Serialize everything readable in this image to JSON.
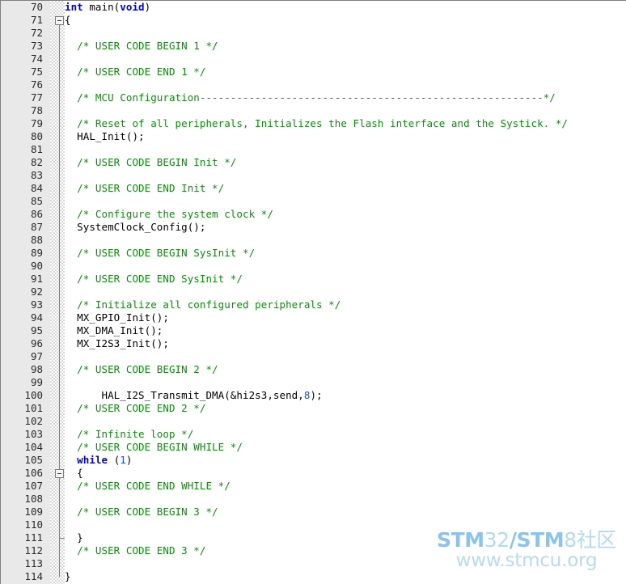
{
  "editor": {
    "language": "c",
    "first_line_number": 70,
    "last_line_number": 114,
    "gutter_bg": "#e9e9e9",
    "background": "#ffffff",
    "comment_color": "#128a12",
    "keyword_color": "#0000d0",
    "number_color": "#1a4fd0",
    "text_color": "#000000"
  },
  "lines": [
    {
      "n": "70",
      "tokens": [
        {
          "t": "int ",
          "c": "kw"
        },
        {
          "t": "main(",
          "c": "pln"
        },
        {
          "t": "void",
          "c": "kw"
        },
        {
          "t": ")",
          "c": "pln"
        }
      ]
    },
    {
      "n": "71",
      "fold": "open",
      "tokens": [
        {
          "t": "{",
          "c": "pln"
        }
      ]
    },
    {
      "n": "72",
      "tokens": []
    },
    {
      "n": "73",
      "tokens": [
        {
          "t": "  /* USER CODE BEGIN 1 */",
          "c": "cmt"
        }
      ]
    },
    {
      "n": "74",
      "tokens": []
    },
    {
      "n": "75",
      "tokens": [
        {
          "t": "  /* USER CODE END 1 */",
          "c": "cmt"
        }
      ]
    },
    {
      "n": "76",
      "tokens": []
    },
    {
      "n": "77",
      "tokens": [
        {
          "t": "  /* MCU Configuration--------------------------------------------------------*/",
          "c": "cmt"
        }
      ]
    },
    {
      "n": "78",
      "tokens": []
    },
    {
      "n": "79",
      "tokens": [
        {
          "t": "  /* Reset of all peripherals, Initializes the Flash interface and the Systick. */",
          "c": "cmt"
        }
      ]
    },
    {
      "n": "80",
      "tokens": [
        {
          "t": "  HAL_Init();",
          "c": "pln"
        }
      ]
    },
    {
      "n": "81",
      "tokens": []
    },
    {
      "n": "82",
      "tokens": [
        {
          "t": "  /* USER CODE BEGIN Init */",
          "c": "cmt"
        }
      ]
    },
    {
      "n": "83",
      "tokens": []
    },
    {
      "n": "84",
      "tokens": [
        {
          "t": "  /* USER CODE END Init */",
          "c": "cmt"
        }
      ]
    },
    {
      "n": "85",
      "tokens": []
    },
    {
      "n": "86",
      "tokens": [
        {
          "t": "  /* Configure the system clock */",
          "c": "cmt"
        }
      ]
    },
    {
      "n": "87",
      "tokens": [
        {
          "t": "  SystemClock_Config();",
          "c": "pln"
        }
      ]
    },
    {
      "n": "88",
      "tokens": []
    },
    {
      "n": "89",
      "tokens": [
        {
          "t": "  /* USER CODE BEGIN SysInit */",
          "c": "cmt"
        }
      ]
    },
    {
      "n": "90",
      "tokens": []
    },
    {
      "n": "91",
      "tokens": [
        {
          "t": "  /* USER CODE END SysInit */",
          "c": "cmt"
        }
      ]
    },
    {
      "n": "92",
      "tokens": []
    },
    {
      "n": "93",
      "tokens": [
        {
          "t": "  /* Initialize all configured peripherals */",
          "c": "cmt"
        }
      ]
    },
    {
      "n": "94",
      "tokens": [
        {
          "t": "  MX_GPIO_Init();",
          "c": "pln"
        }
      ]
    },
    {
      "n": "95",
      "tokens": [
        {
          "t": "  MX_DMA_Init();",
          "c": "pln"
        }
      ]
    },
    {
      "n": "96",
      "tokens": [
        {
          "t": "  MX_I2S3_Init();",
          "c": "pln"
        }
      ]
    },
    {
      "n": "97",
      "tokens": []
    },
    {
      "n": "98",
      "tokens": [
        {
          "t": "  /* USER CODE BEGIN 2 */",
          "c": "cmt"
        }
      ]
    },
    {
      "n": "99",
      "tokens": []
    },
    {
      "n": "100",
      "tokens": [
        {
          "t": "      HAL_I2S_Transmit_DMA(&hi2s3,send,",
          "c": "pln"
        },
        {
          "t": "8",
          "c": "num"
        },
        {
          "t": ");",
          "c": "pln"
        }
      ]
    },
    {
      "n": "101",
      "tokens": [
        {
          "t": "  /* USER CODE END 2 */",
          "c": "cmt"
        }
      ]
    },
    {
      "n": "102",
      "tokens": []
    },
    {
      "n": "103",
      "tokens": [
        {
          "t": "  /* Infinite loop */",
          "c": "cmt"
        }
      ]
    },
    {
      "n": "104",
      "tokens": [
        {
          "t": "  /* USER CODE BEGIN WHILE */",
          "c": "cmt"
        }
      ]
    },
    {
      "n": "105",
      "tokens": [
        {
          "t": "  ",
          "c": "pln"
        },
        {
          "t": "while",
          "c": "kw"
        },
        {
          "t": " (",
          "c": "pln"
        },
        {
          "t": "1",
          "c": "num"
        },
        {
          "t": ")",
          "c": "pln"
        }
      ]
    },
    {
      "n": "106",
      "fold": "open",
      "tokens": [
        {
          "t": "  {",
          "c": "pln"
        }
      ]
    },
    {
      "n": "107",
      "tokens": [
        {
          "t": "  /* USER CODE END WHILE */",
          "c": "cmt"
        }
      ]
    },
    {
      "n": "108",
      "tokens": []
    },
    {
      "n": "109",
      "tokens": [
        {
          "t": "  /* USER CODE BEGIN 3 */",
          "c": "cmt"
        }
      ]
    },
    {
      "n": "110",
      "tokens": []
    },
    {
      "n": "111",
      "fold": "end",
      "tokens": [
        {
          "t": "  }",
          "c": "pln"
        }
      ]
    },
    {
      "n": "112",
      "tokens": [
        {
          "t": "  /* USER CODE END 3 */",
          "c": "cmt"
        }
      ]
    },
    {
      "n": "113",
      "tokens": []
    },
    {
      "n": "114",
      "tokens": [
        {
          "t": "}",
          "c": "pln"
        }
      ]
    }
  ],
  "watermark": {
    "brand_bold_1": "STM",
    "brand_light_1": "32",
    "brand_bold_2": "/STM",
    "brand_light_2": "8社区",
    "url": "www.stmcu.org",
    "color_bold": "#8cc3e9",
    "color_light": "#b5d9f0"
  }
}
